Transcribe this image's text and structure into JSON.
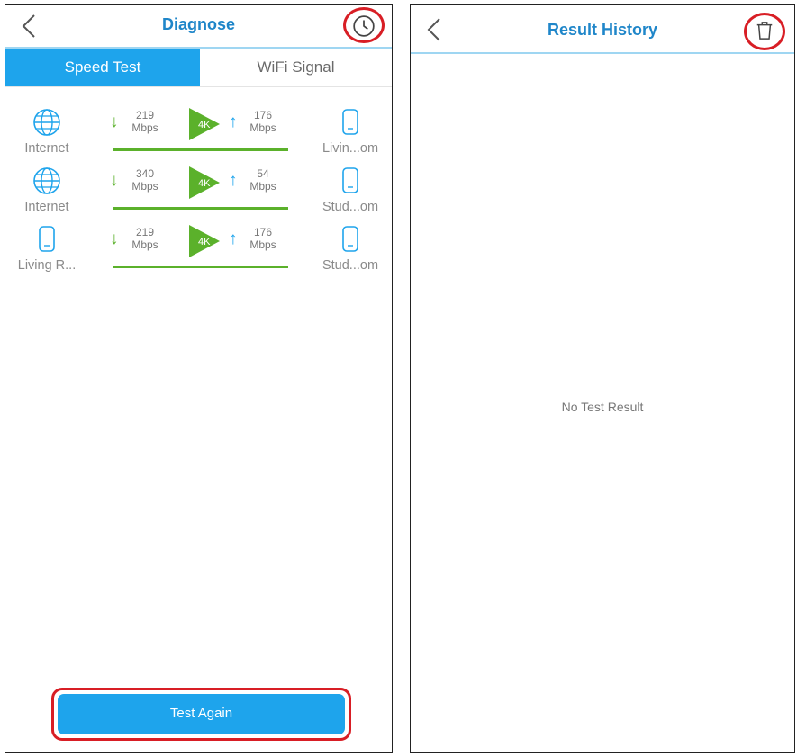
{
  "diagnose": {
    "title": "Diagnose",
    "tabs": [
      {
        "label": "Speed Test",
        "active": true
      },
      {
        "label": "WiFi Signal",
        "active": false
      }
    ],
    "results": [
      {
        "left_label": "Internet",
        "left_icon": "globe-icon",
        "down_value": "219",
        "down_unit": "Mbps",
        "badge": "4K",
        "up_value": "176",
        "up_unit": "Mbps",
        "right_label": "Livin...om",
        "right_icon": "router-icon"
      },
      {
        "left_label": "Internet",
        "left_icon": "globe-icon",
        "down_value": "340",
        "down_unit": "Mbps",
        "badge": "4K",
        "up_value": "54",
        "up_unit": "Mbps",
        "right_label": "Stud...om",
        "right_icon": "router-icon"
      },
      {
        "left_label": "Living R...",
        "left_icon": "router-icon",
        "down_value": "219",
        "down_unit": "Mbps",
        "badge": "4K",
        "up_value": "176",
        "up_unit": "Mbps",
        "right_label": "Stud...om",
        "right_icon": "router-icon"
      }
    ],
    "test_again_label": "Test Again"
  },
  "history": {
    "title": "Result History",
    "empty_text": "No Test Result"
  },
  "colors": {
    "accent_blue": "#1ea4ec",
    "title_blue": "#1f86c9",
    "green": "#5bb12b",
    "highlight_red": "#d81e25"
  },
  "icons": {
    "back": "chevron-left-icon",
    "history": "clock-icon",
    "delete": "trash-icon",
    "download": "arrow-down-icon",
    "upload": "arrow-up-icon"
  }
}
